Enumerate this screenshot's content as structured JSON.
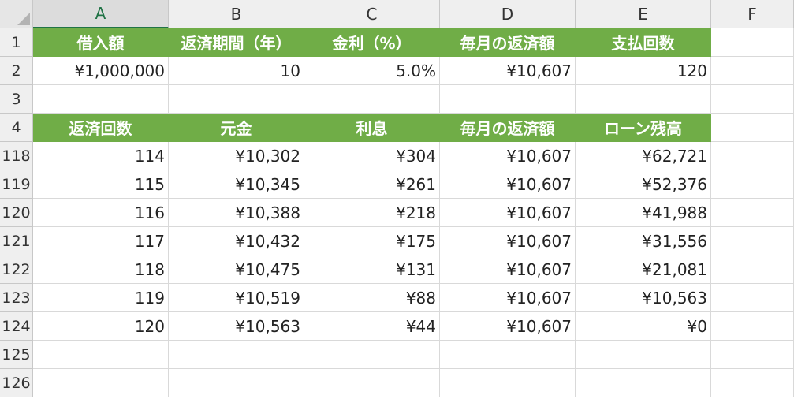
{
  "columns": [
    "A",
    "B",
    "C",
    "D",
    "E",
    "F"
  ],
  "selected_column": "A",
  "row_numbers": [
    "1",
    "2",
    "3",
    "4",
    "118",
    "119",
    "120",
    "121",
    "122",
    "123",
    "124",
    "125",
    "126"
  ],
  "row1": [
    "借入額",
    "返済期間（年）",
    "金利（%）",
    "毎月の返済額",
    "支払回数"
  ],
  "row2": [
    "¥1,000,000",
    "10",
    "5.0%",
    "¥10,607",
    "120"
  ],
  "row4": [
    "返済回数",
    "元金",
    "利息",
    "毎月の返済額",
    "ローン残高"
  ],
  "schedule": [
    [
      "114",
      "¥10,302",
      "¥304",
      "¥10,607",
      "¥62,721"
    ],
    [
      "115",
      "¥10,345",
      "¥261",
      "¥10,607",
      "¥52,376"
    ],
    [
      "116",
      "¥10,388",
      "¥218",
      "¥10,607",
      "¥41,988"
    ],
    [
      "117",
      "¥10,432",
      "¥175",
      "¥10,607",
      "¥31,556"
    ],
    [
      "118",
      "¥10,475",
      "¥131",
      "¥10,607",
      "¥21,081"
    ],
    [
      "119",
      "¥10,519",
      "¥88",
      "¥10,607",
      "¥10,563"
    ],
    [
      "120",
      "¥10,563",
      "¥44",
      "¥10,607",
      "¥0"
    ]
  ],
  "colors": {
    "header_fill": "#70ad47",
    "header_text": "#ffffff",
    "grid": "#d9d9d9"
  }
}
